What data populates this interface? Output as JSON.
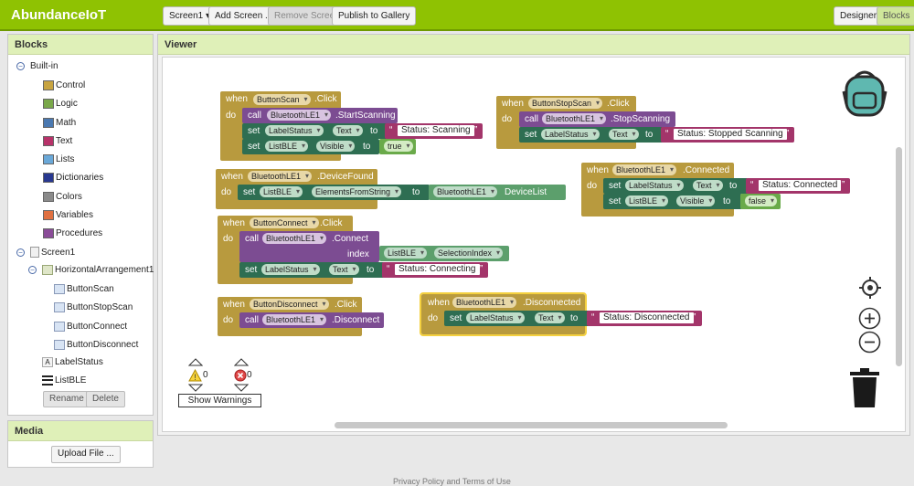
{
  "app": {
    "title": "AbundanceIoT"
  },
  "toolbar": {
    "screen_select": "Screen1 ▾",
    "add_screen": "Add Screen ...",
    "remove_screen": "Remove Screen",
    "publish": "Publish to Gallery",
    "designer": "Designer",
    "blocks": "Blocks"
  },
  "blocks_panel": {
    "title": "Blocks",
    "builtin": "Built-in",
    "builtin_items": [
      {
        "label": "Control",
        "color": "#c8a440"
      },
      {
        "label": "Logic",
        "color": "#7aa84a"
      },
      {
        "label": "Math",
        "color": "#4a78b0"
      },
      {
        "label": "Text",
        "color": "#b8336a"
      },
      {
        "label": "Lists",
        "color": "#6aa8d8"
      },
      {
        "label": "Dictionaries",
        "color": "#283890"
      },
      {
        "label": "Colors",
        "color": "#8a8a8a"
      },
      {
        "label": "Variables",
        "color": "#e07040"
      },
      {
        "label": "Procedures",
        "color": "#8a4c98"
      }
    ],
    "screen": "Screen1",
    "arrangement": "HorizontalArrangement1",
    "buttons": [
      "ButtonScan",
      "ButtonStopScan",
      "ButtonConnect",
      "ButtonDisconnect"
    ],
    "label": "LabelStatus",
    "list": "ListBLE",
    "rename": "Rename",
    "delete": "Delete"
  },
  "media": {
    "title": "Media",
    "upload": "Upload File ..."
  },
  "viewer": {
    "title": "Viewer",
    "warnings_count": "0",
    "errors_count": "0",
    "show_warnings": "Show Warnings"
  },
  "kw": {
    "when": "when",
    "do": "do",
    "call": "call",
    "set": "set",
    "to": "to",
    "index": "index",
    "q": "“",
    "qe": "”"
  },
  "b1": {
    "comp": "ButtonScan",
    "event": ".Click",
    "ble": "BluetoothLE1",
    "method": ".StartScanning",
    "label": "LabelStatus",
    "prop": "Text",
    "str": "Status: Scanning",
    "list": "ListBLE",
    "prop2": "Visible",
    "bool": "true"
  },
  "b2": {
    "comp": "ButtonStopScan",
    "event": ".Click",
    "ble": "BluetoothLE1",
    "method": ".StopScanning",
    "label": "LabelStatus",
    "prop": "Text",
    "str": "Status: Stopped Scanning"
  },
  "b3": {
    "comp": "BluetoothLE1",
    "event": ".DeviceFound",
    "list": "ListBLE",
    "prop": "ElementsFromString",
    "ble": "BluetoothLE1",
    "prop2": "DeviceList"
  },
  "b4": {
    "comp": "BluetoothLE1",
    "event": ".Connected",
    "label": "LabelStatus",
    "prop": "Text",
    "str": "Status: Connected",
    "list": "ListBLE",
    "prop2": "Visible",
    "bool": "false"
  },
  "b5": {
    "comp": "ButtonConnect",
    "event": ".Click",
    "ble": "BluetoothLE1",
    "method": ".Connect",
    "list": "ListBLE",
    "prop": "SelectionIndex",
    "label": "LabelStatus",
    "prop2": "Text",
    "str": "Status: Connecting"
  },
  "b6": {
    "comp": "ButtonDisconnect",
    "event": ".Click",
    "ble": "BluetoothLE1",
    "method": ".Disconnect"
  },
  "b7": {
    "comp": "BluetoothLE1",
    "event": ".Disconnected",
    "label": "LabelStatus",
    "prop": "Text",
    "str": "Status: Disconnected"
  },
  "footer": {
    "text": "Privacy Policy and Terms of Use"
  }
}
